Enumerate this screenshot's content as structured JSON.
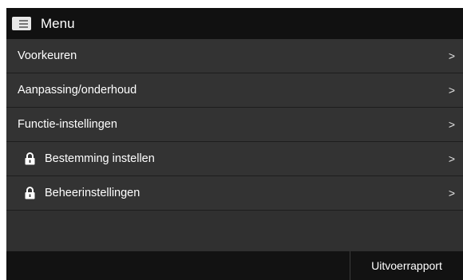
{
  "header": {
    "title": "Menu",
    "icon": "menu-list-icon"
  },
  "items": [
    {
      "label": "Voorkeuren",
      "locked": false
    },
    {
      "label": "Aanpassing/onderhoud",
      "locked": false
    },
    {
      "label": "Functie-instellingen",
      "locked": false
    },
    {
      "label": "Bestemming instellen",
      "locked": true,
      "icon": "lock-icon"
    },
    {
      "label": "Beheerinstellingen",
      "locked": true,
      "icon": "lock-icon"
    }
  ],
  "chevron": ">",
  "footer": {
    "report_label": "Uitvoerrapport"
  },
  "colors": {
    "header_bg": "#111111",
    "list_bg": "#333333",
    "footer_bg": "#121212",
    "text": "#ffffff"
  }
}
